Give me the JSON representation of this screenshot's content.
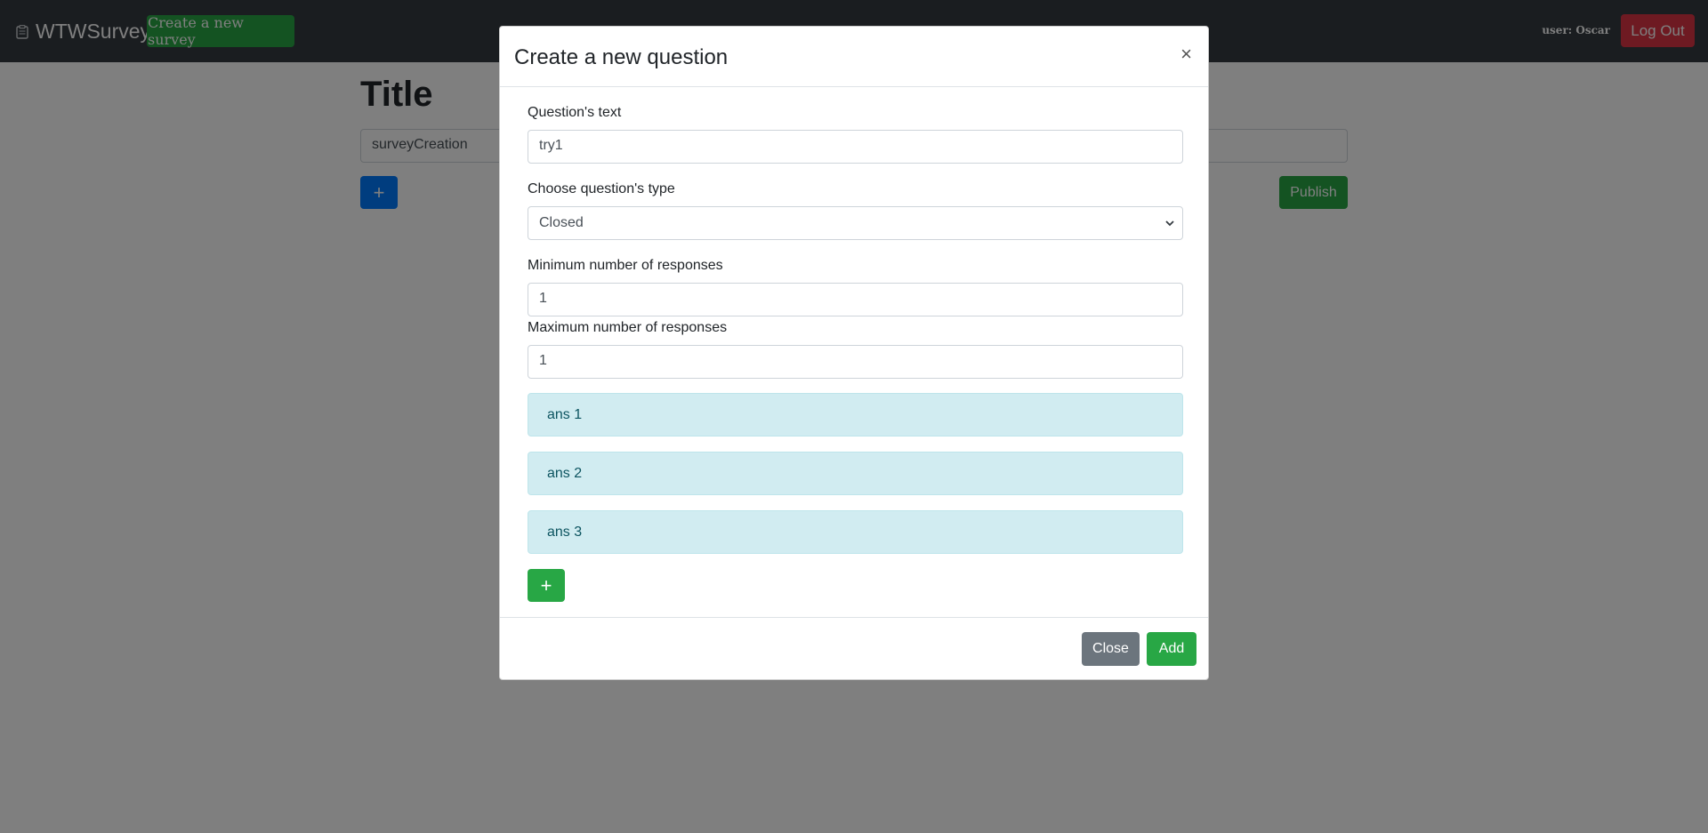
{
  "navbar": {
    "brand": "WTWSurvey",
    "brand_icon": "clipboard-icon",
    "create_survey_label": "Create a new survey",
    "user_label": "user: Oscar",
    "logout_label": "Log Out"
  },
  "page": {
    "title": "Title",
    "survey_title_value": "surveyCreation",
    "add_question_label": "+",
    "publish_label": "Publish"
  },
  "modal": {
    "title": "Create a new question",
    "close_x": "×",
    "question_text_label": "Question's text",
    "question_text_value": "try1",
    "type_label": "Choose question's type",
    "type_selected": "Closed",
    "min_label": "Minimum number of responses",
    "min_value": "1",
    "max_label": "Maximum number of responses",
    "max_value": "1",
    "answers": [
      "ans 1",
      "ans 2",
      "ans 3"
    ],
    "add_answer_label": "+",
    "close_label": "Close",
    "add_label": "Add"
  },
  "colors": {
    "navbar": "#343a40",
    "success": "#28a745",
    "primary": "#007bff",
    "danger": "#dc3545",
    "secondary": "#6c757d",
    "info_bg": "#d1ecf1"
  }
}
